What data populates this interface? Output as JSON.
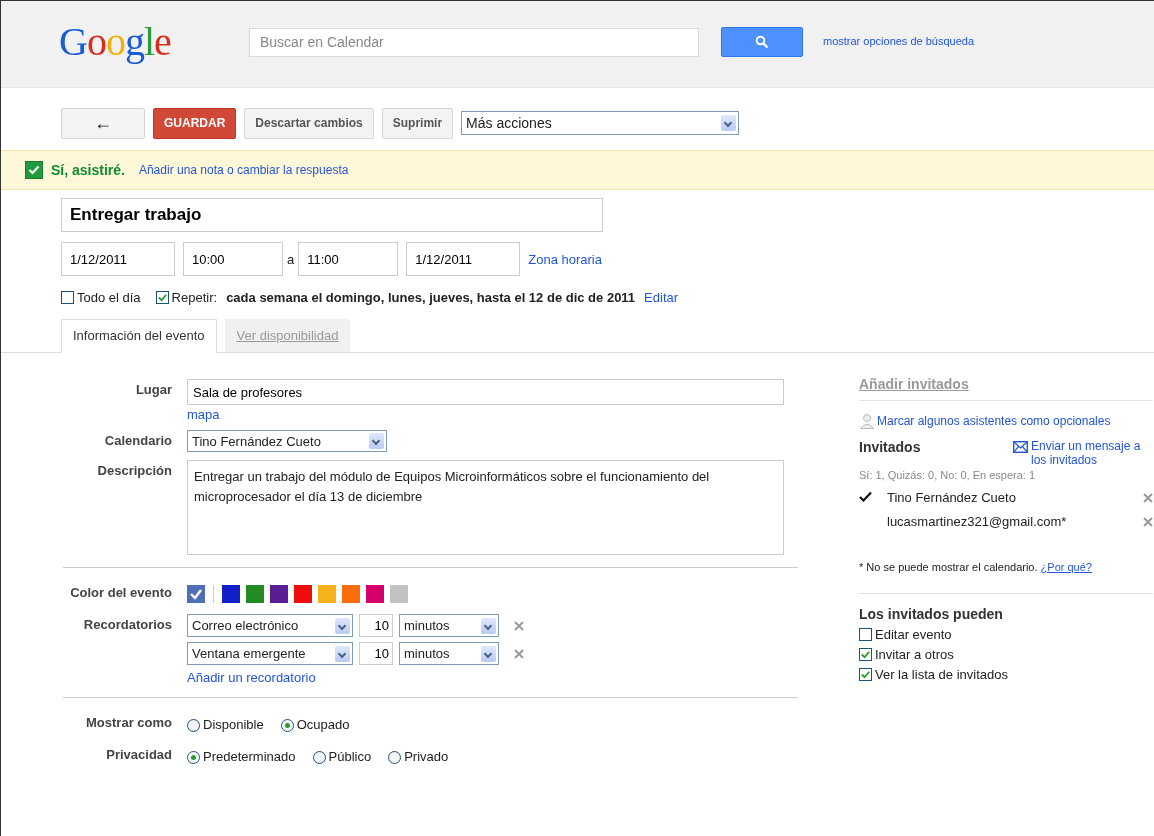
{
  "header": {
    "logo": "Google",
    "search": {
      "placeholder": "Buscar en Calendar"
    },
    "search_options_link": "mostrar opciones de búsqueda"
  },
  "toolbar": {
    "back_glyph": "←",
    "buttons": [
      {
        "label": "GUARDAR",
        "kind": "primary"
      },
      {
        "label": "Descartar cambios",
        "kind": "normal"
      },
      {
        "label": "Suprimir",
        "kind": "normal"
      }
    ],
    "more_actions": "Más acciones"
  },
  "rsvp": {
    "checked": true,
    "label": "Sí, asistiré.",
    "link": "Añadir una nota o cambiar la respuesta"
  },
  "event": {
    "title": "Entregar trabajo",
    "start_date": "1/12/2011",
    "start_time": "10:00",
    "separator": "a",
    "end_time": "11:00",
    "end_date": "1/12/2011",
    "timezone_link": "Zona horaria",
    "all_day": {
      "label": "Todo el día",
      "checked": false
    },
    "repeat": {
      "label": "Repetir:",
      "checked": true,
      "summary": "cada semana el domingo, lunes, jueves, hasta el 12 de dic de 2011",
      "edit_link": "Editar"
    }
  },
  "tabs": [
    {
      "label": "Información del evento",
      "selected": true
    },
    {
      "label": "Ver disponibilidad",
      "selected": false
    }
  ],
  "details": {
    "location_label": "Lugar",
    "location": "Sala de profesores",
    "map_link": "mapa",
    "calendar_label": "Calendario",
    "calendar": "Tino Fernández Cueto",
    "description_label": "Descripción",
    "description": "Entregar un trabajo del módulo de Equipos Microinformáticos sobre el funcionamiento del microprocesador el día 13 de diciembre",
    "color_label": "Color del evento",
    "colors": [
      {
        "color": "#4e6fb5",
        "selected": true
      },
      {
        "color": "#1220c8",
        "selected": false
      },
      {
        "color": "#248a24",
        "selected": false
      },
      {
        "color": "#5a1d96",
        "selected": false
      },
      {
        "color": "#f20d0d",
        "selected": false
      },
      {
        "color": "#f7b31b",
        "selected": false
      },
      {
        "color": "#fa6b0a",
        "selected": false
      },
      {
        "color": "#d6006d",
        "selected": false
      },
      {
        "color": "#c2c2c2",
        "selected": false
      }
    ],
    "reminders_label": "Recordatorios",
    "reminders": [
      {
        "method": "Correo electrónico",
        "amount": "10",
        "unit": "minutos"
      },
      {
        "method": "Ventana emergente",
        "amount": "10",
        "unit": "minutos"
      }
    ],
    "add_reminder_link": "Añadir un recordatorio",
    "show_as_label": "Mostrar como",
    "show_as": [
      {
        "label": "Disponible",
        "selected": false
      },
      {
        "label": "Ocupado",
        "selected": true
      }
    ],
    "privacy_label": "Privacidad",
    "privacy": [
      {
        "label": "Predeterminado",
        "selected": true
      },
      {
        "label": "Público",
        "selected": false
      },
      {
        "label": "Privado",
        "selected": false
      }
    ]
  },
  "guests": {
    "add_title": "Añadir invitados",
    "optional_link": "Marcar algunos asistentes como opcionales",
    "title": "Invitados",
    "message_link": "Enviar un mensaje a los invitados",
    "summary": "Sí: 1, Quizás: 0, No: 0, En espera: 1",
    "list": [
      {
        "name": "Tino Fernández Cueto",
        "accepted": true
      },
      {
        "name": "lucasmartinez321@gmail.com*",
        "accepted": false
      }
    ],
    "note": "* No se puede mostrar el calendario.",
    "why_link": "¿Por qué?",
    "permissions_title": "Los invitados pueden",
    "permissions": [
      {
        "label": "Editar evento",
        "checked": false
      },
      {
        "label": "Invitar a otros",
        "checked": true
      },
      {
        "label": "Ver la lista de invitados",
        "checked": true
      }
    ]
  }
}
